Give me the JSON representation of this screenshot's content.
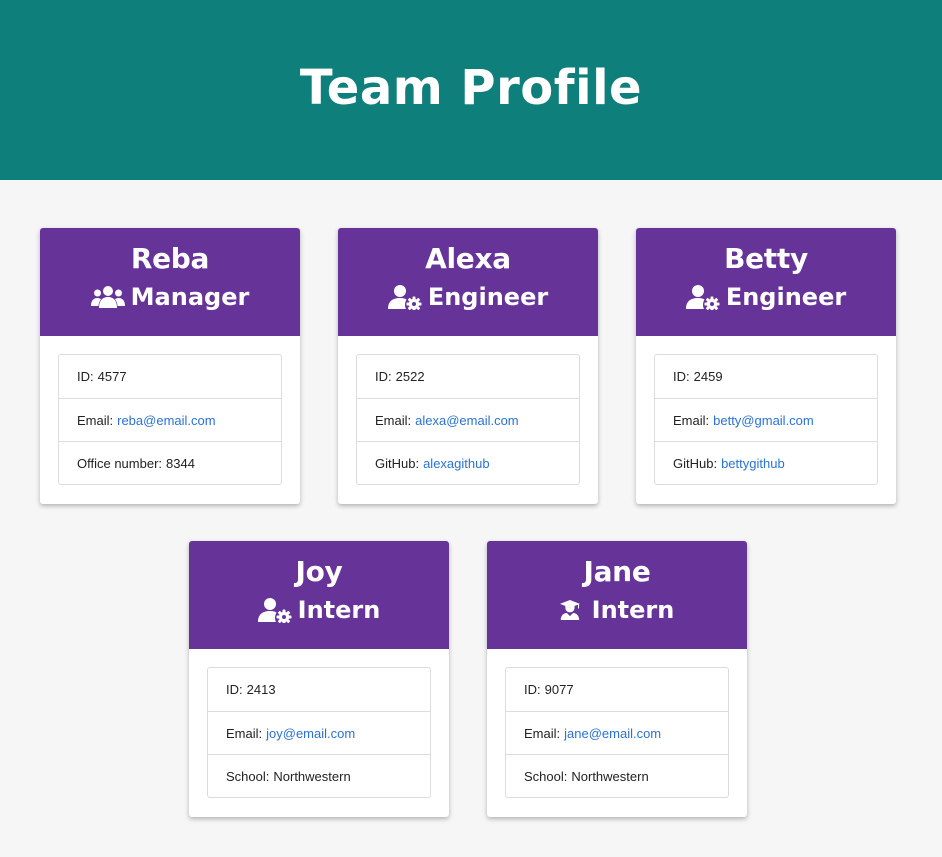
{
  "header": {
    "title": "Team Profile"
  },
  "colors": {
    "header_bg": "#0f7f7b",
    "card_head_bg": "#663399",
    "link": "#2a72d6"
  },
  "cards": [
    {
      "name": "Reba",
      "role": "Manager",
      "icon": "users-icon",
      "id_label": "ID:",
      "id": "4577",
      "email_label": "Email:",
      "email": "reba@email.com",
      "extra_label": "Office number:",
      "extra": "8344"
    },
    {
      "name": "Alexa",
      "role": "Engineer",
      "icon": "user-gear-icon",
      "id_label": "ID:",
      "id": "2522",
      "email_label": "Email:",
      "email": "alexa@email.com",
      "extra_label": "GitHub:",
      "extra": "alexagithub"
    },
    {
      "name": "Betty",
      "role": "Engineer",
      "icon": "user-gear-icon",
      "id_label": "ID:",
      "id": "2459",
      "email_label": "Email:",
      "email": "betty@gmail.com",
      "extra_label": "GitHub:",
      "extra": "bettygithub"
    },
    {
      "name": "Joy",
      "role": "Intern",
      "icon": "user-gear-icon",
      "id_label": "ID:",
      "id": "2413",
      "email_label": "Email:",
      "email": "joy@email.com",
      "extra_label": "School:",
      "extra": "Northwestern"
    },
    {
      "name": "Jane",
      "role": "Intern",
      "icon": "user-graduate-icon",
      "id_label": "ID:",
      "id": "9077",
      "email_label": "Email:",
      "email": "jane@email.com",
      "extra_label": "School:",
      "extra": "Northwestern"
    }
  ]
}
